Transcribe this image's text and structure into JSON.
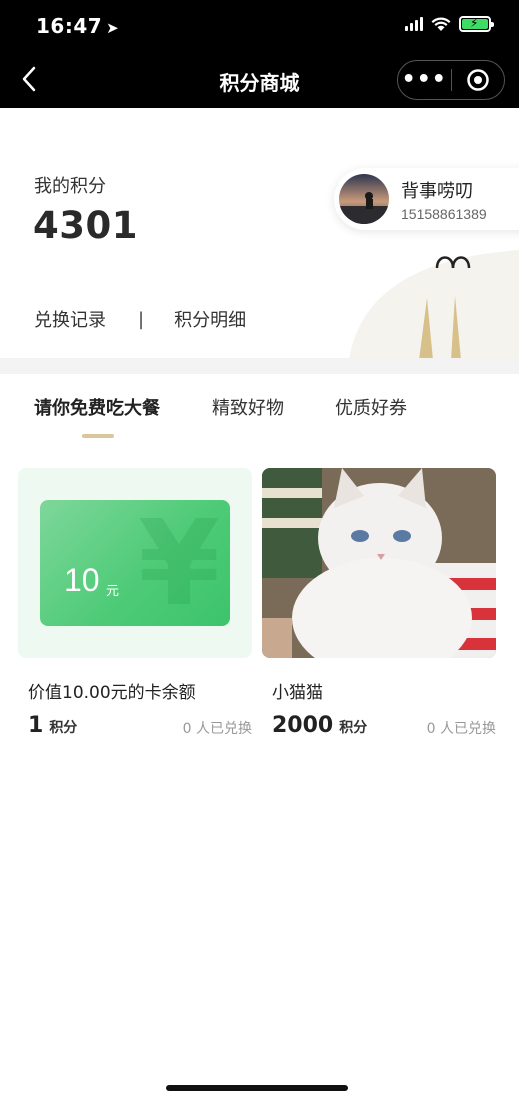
{
  "status": {
    "time": "16:47"
  },
  "nav": {
    "title": "积分商城",
    "more_icon": "more-dots-icon",
    "close_icon": "target-icon"
  },
  "points": {
    "label": "我的积分",
    "value": "4301",
    "links": [
      "兑换记录",
      "|",
      "积分明细"
    ]
  },
  "user": {
    "name": "背事唠叨",
    "phone": "15158861389"
  },
  "tabs": [
    {
      "label": "请你免费吃大餐",
      "active": true
    },
    {
      "label": "精致好物",
      "active": false
    },
    {
      "label": "优质好券",
      "active": false
    }
  ],
  "products": [
    {
      "title": "价值10.00元的卡余额",
      "points": "1",
      "unit": "积分",
      "exchanged": "0 人已兑换",
      "voucher_amount": "10",
      "voucher_unit": "元"
    },
    {
      "title": "小猫猫",
      "points": "2000",
      "unit": "积分",
      "exchanged": "0 人已兑换"
    }
  ],
  "colors": {
    "accent": "#d9c69a",
    "voucher_green": "#4fcb78",
    "topbar": "#000000"
  }
}
